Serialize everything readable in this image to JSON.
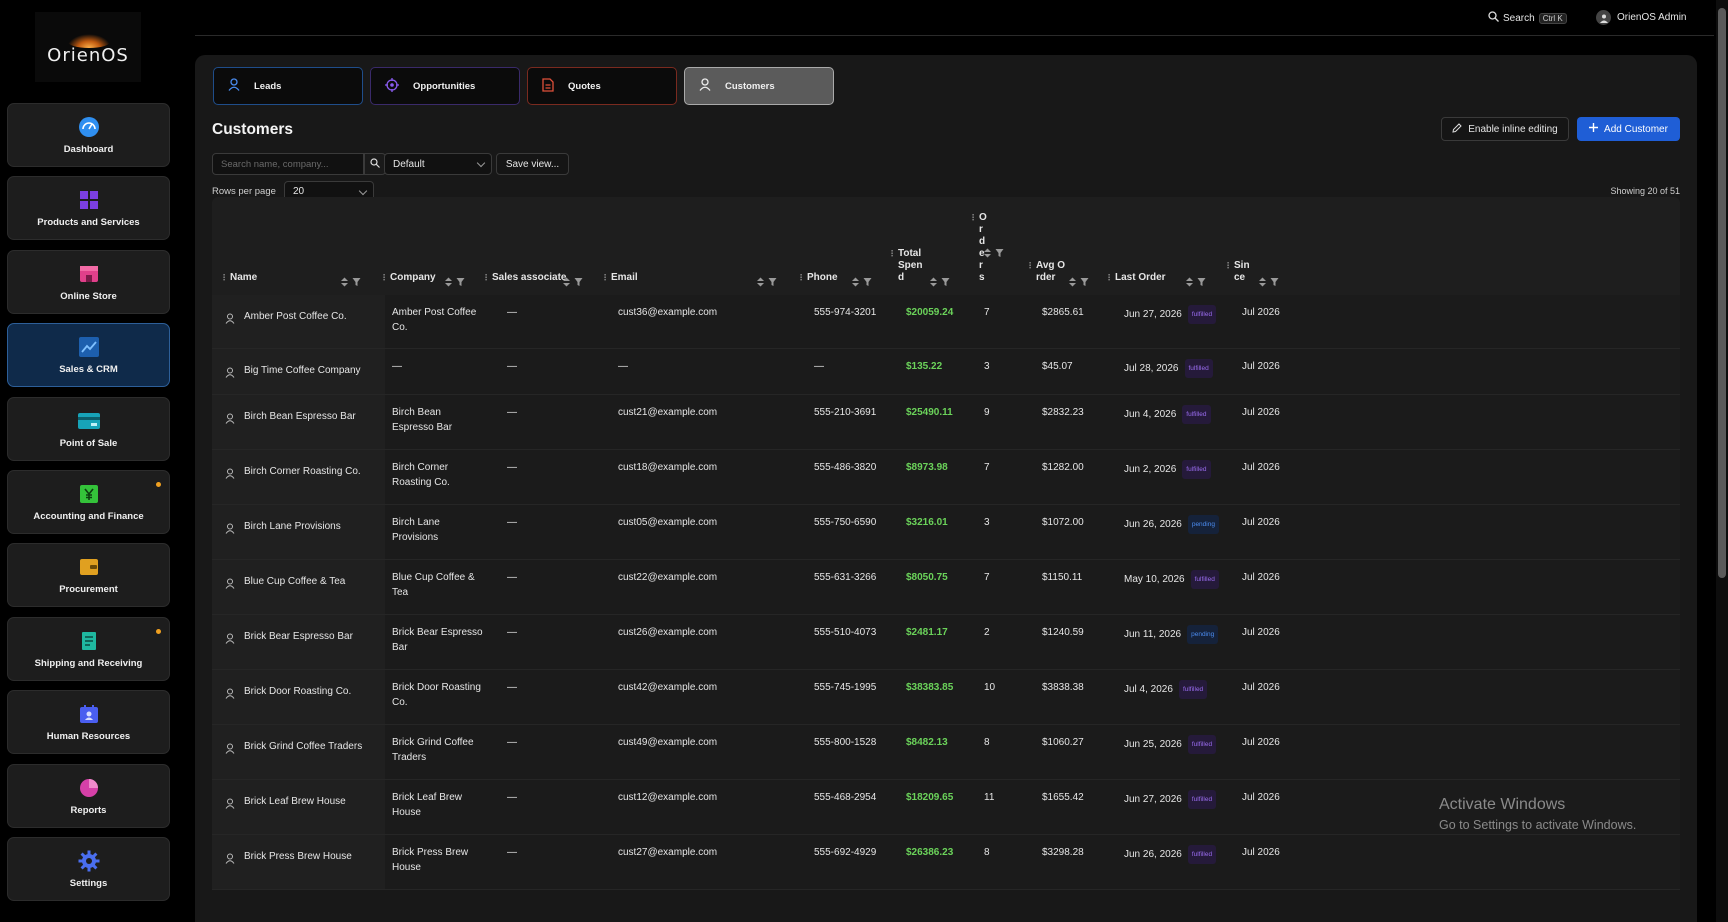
{
  "app": {
    "logo_text": "OrienOS"
  },
  "sidebar": {
    "items": [
      {
        "label": "Dashboard",
        "icon": "gauge-icon",
        "color": "#2f8ff0"
      },
      {
        "label": "Products and Services",
        "icon": "grid-icon",
        "color": "#7b3fe0"
      },
      {
        "label": "Online Store",
        "icon": "store-icon",
        "color": "#e0408a"
      },
      {
        "label": "Sales & CRM",
        "icon": "chart-line-icon",
        "color": "#2f8ff0"
      },
      {
        "label": "Point of Sale",
        "icon": "card-icon",
        "color": "#17a3b8"
      },
      {
        "label": "Accounting and Finance",
        "icon": "yen-icon",
        "color": "#34c23a"
      },
      {
        "label": "Procurement",
        "icon": "wallet-icon",
        "color": "#e0a020"
      },
      {
        "label": "Shipping and Receiving",
        "icon": "receipt-icon",
        "color": "#1fb8a0"
      },
      {
        "label": "Human Resources",
        "icon": "calendar-user-icon",
        "color": "#4a5ef0"
      },
      {
        "label": "Reports",
        "icon": "pie-icon",
        "color": "#d640a8"
      },
      {
        "label": "Settings",
        "icon": "gear-icon",
        "color": "#4a6ef0"
      }
    ]
  },
  "topbar": {
    "search_label": "Search",
    "search_shortcut": "Ctrl K",
    "user_name": "OrienOS Admin"
  },
  "tabs": [
    {
      "label": "Leads"
    },
    {
      "label": "Opportunities"
    },
    {
      "label": "Quotes"
    },
    {
      "label": "Customers"
    }
  ],
  "page": {
    "title": "Customers",
    "inline_edit_label": "Enable inline editing",
    "add_label": "Add Customer",
    "search_placeholder": "Search name, company...",
    "view_selected": "Default",
    "save_view_label": "Save view...",
    "rows_per_page_label": "Rows per page",
    "rows_per_page_value": "20",
    "showing_text": "Showing 20 of 51"
  },
  "table": {
    "headers": {
      "name": "Name",
      "company": "Company",
      "sales_associate": "Sales associate",
      "email": "Email",
      "phone": "Phone",
      "total_spend": "Total Spend",
      "orders": "Orders",
      "avg_order": "Avg Order",
      "last_order": "Last Order",
      "since": "Since"
    },
    "rows": [
      {
        "name": "Amber Post Coffee Co.",
        "company": "Amber Post Coffee Co.",
        "associate": "—",
        "email": "cust36@example.com",
        "phone": "555-974-3201",
        "spend": "$20059.24",
        "orders": "7",
        "avg": "$2865.61",
        "last": "Jun 27, 2026",
        "status": "fulfilled",
        "since": "Jul 2026"
      },
      {
        "name": "Big Time Coffee Company",
        "company": "—",
        "associate": "—",
        "email": "—",
        "phone": "—",
        "spend": "$135.22",
        "orders": "3",
        "avg": "$45.07",
        "last": "Jul 28, 2026",
        "status": "fulfilled",
        "since": "Jul 2026"
      },
      {
        "name": "Birch Bean Espresso Bar",
        "company": "Birch Bean Espresso Bar",
        "associate": "—",
        "email": "cust21@example.com",
        "phone": "555-210-3691",
        "spend": "$25490.11",
        "orders": "9",
        "avg": "$2832.23",
        "last": "Jun 4, 2026",
        "status": "fulfilled",
        "since": "Jul 2026"
      },
      {
        "name": "Birch Corner Roasting Co.",
        "company": "Birch Corner Roasting Co.",
        "associate": "—",
        "email": "cust18@example.com",
        "phone": "555-486-3820",
        "spend": "$8973.98",
        "orders": "7",
        "avg": "$1282.00",
        "last": "Jun 2, 2026",
        "status": "fulfilled",
        "since": "Jul 2026"
      },
      {
        "name": "Birch Lane Provisions",
        "company": "Birch Lane Provisions",
        "associate": "—",
        "email": "cust05@example.com",
        "phone": "555-750-6590",
        "spend": "$3216.01",
        "orders": "3",
        "avg": "$1072.00",
        "last": "Jun 26, 2026",
        "status": "pending",
        "since": "Jul 2026"
      },
      {
        "name": "Blue Cup Coffee & Tea",
        "company": "Blue Cup Coffee & Tea",
        "associate": "—",
        "email": "cust22@example.com",
        "phone": "555-631-3266",
        "spend": "$8050.75",
        "orders": "7",
        "avg": "$1150.11",
        "last": "May 10, 2026",
        "status": "fulfilled",
        "since": "Jul 2026"
      },
      {
        "name": "Brick Bear Espresso Bar",
        "company": "Brick Bear Espresso Bar",
        "associate": "—",
        "email": "cust26@example.com",
        "phone": "555-510-4073",
        "spend": "$2481.17",
        "orders": "2",
        "avg": "$1240.59",
        "last": "Jun 11, 2026",
        "status": "pending",
        "since": "Jul 2026"
      },
      {
        "name": "Brick Door Roasting Co.",
        "company": "Brick Door Roasting Co.",
        "associate": "—",
        "email": "cust42@example.com",
        "phone": "555-745-1995",
        "spend": "$38383.85",
        "orders": "10",
        "avg": "$3838.38",
        "last": "Jul 4, 2026",
        "status": "fulfilled",
        "since": "Jul 2026"
      },
      {
        "name": "Brick Grind Coffee Traders",
        "company": "Brick Grind Coffee Traders",
        "associate": "—",
        "email": "cust49@example.com",
        "phone": "555-800-1528",
        "spend": "$8482.13",
        "orders": "8",
        "avg": "$1060.27",
        "last": "Jun 25, 2026",
        "status": "fulfilled",
        "since": "Jul 2026"
      },
      {
        "name": "Brick Leaf Brew House",
        "company": "Brick Leaf Brew House",
        "associate": "—",
        "email": "cust12@example.com",
        "phone": "555-468-2954",
        "spend": "$18209.65",
        "orders": "11",
        "avg": "$1655.42",
        "last": "Jun 27, 2026",
        "status": "fulfilled",
        "since": "Jul 2026"
      },
      {
        "name": "Brick Press Brew House",
        "company": "Brick Press Brew House",
        "associate": "—",
        "email": "cust27@example.com",
        "phone": "555-692-4929",
        "spend": "$26386.23",
        "orders": "8",
        "avg": "$3298.28",
        "last": "Jun 26, 2026",
        "status": "fulfilled",
        "since": "Jul 2026"
      }
    ]
  },
  "watermark": {
    "line1": "Activate Windows",
    "line2": "Go to Settings to activate Windows."
  },
  "colors": {
    "accent": "#1f5ed6",
    "spend_green": "#6bd35a",
    "fulfilled": "#9a6cf0",
    "pending": "#4b8cf0"
  }
}
